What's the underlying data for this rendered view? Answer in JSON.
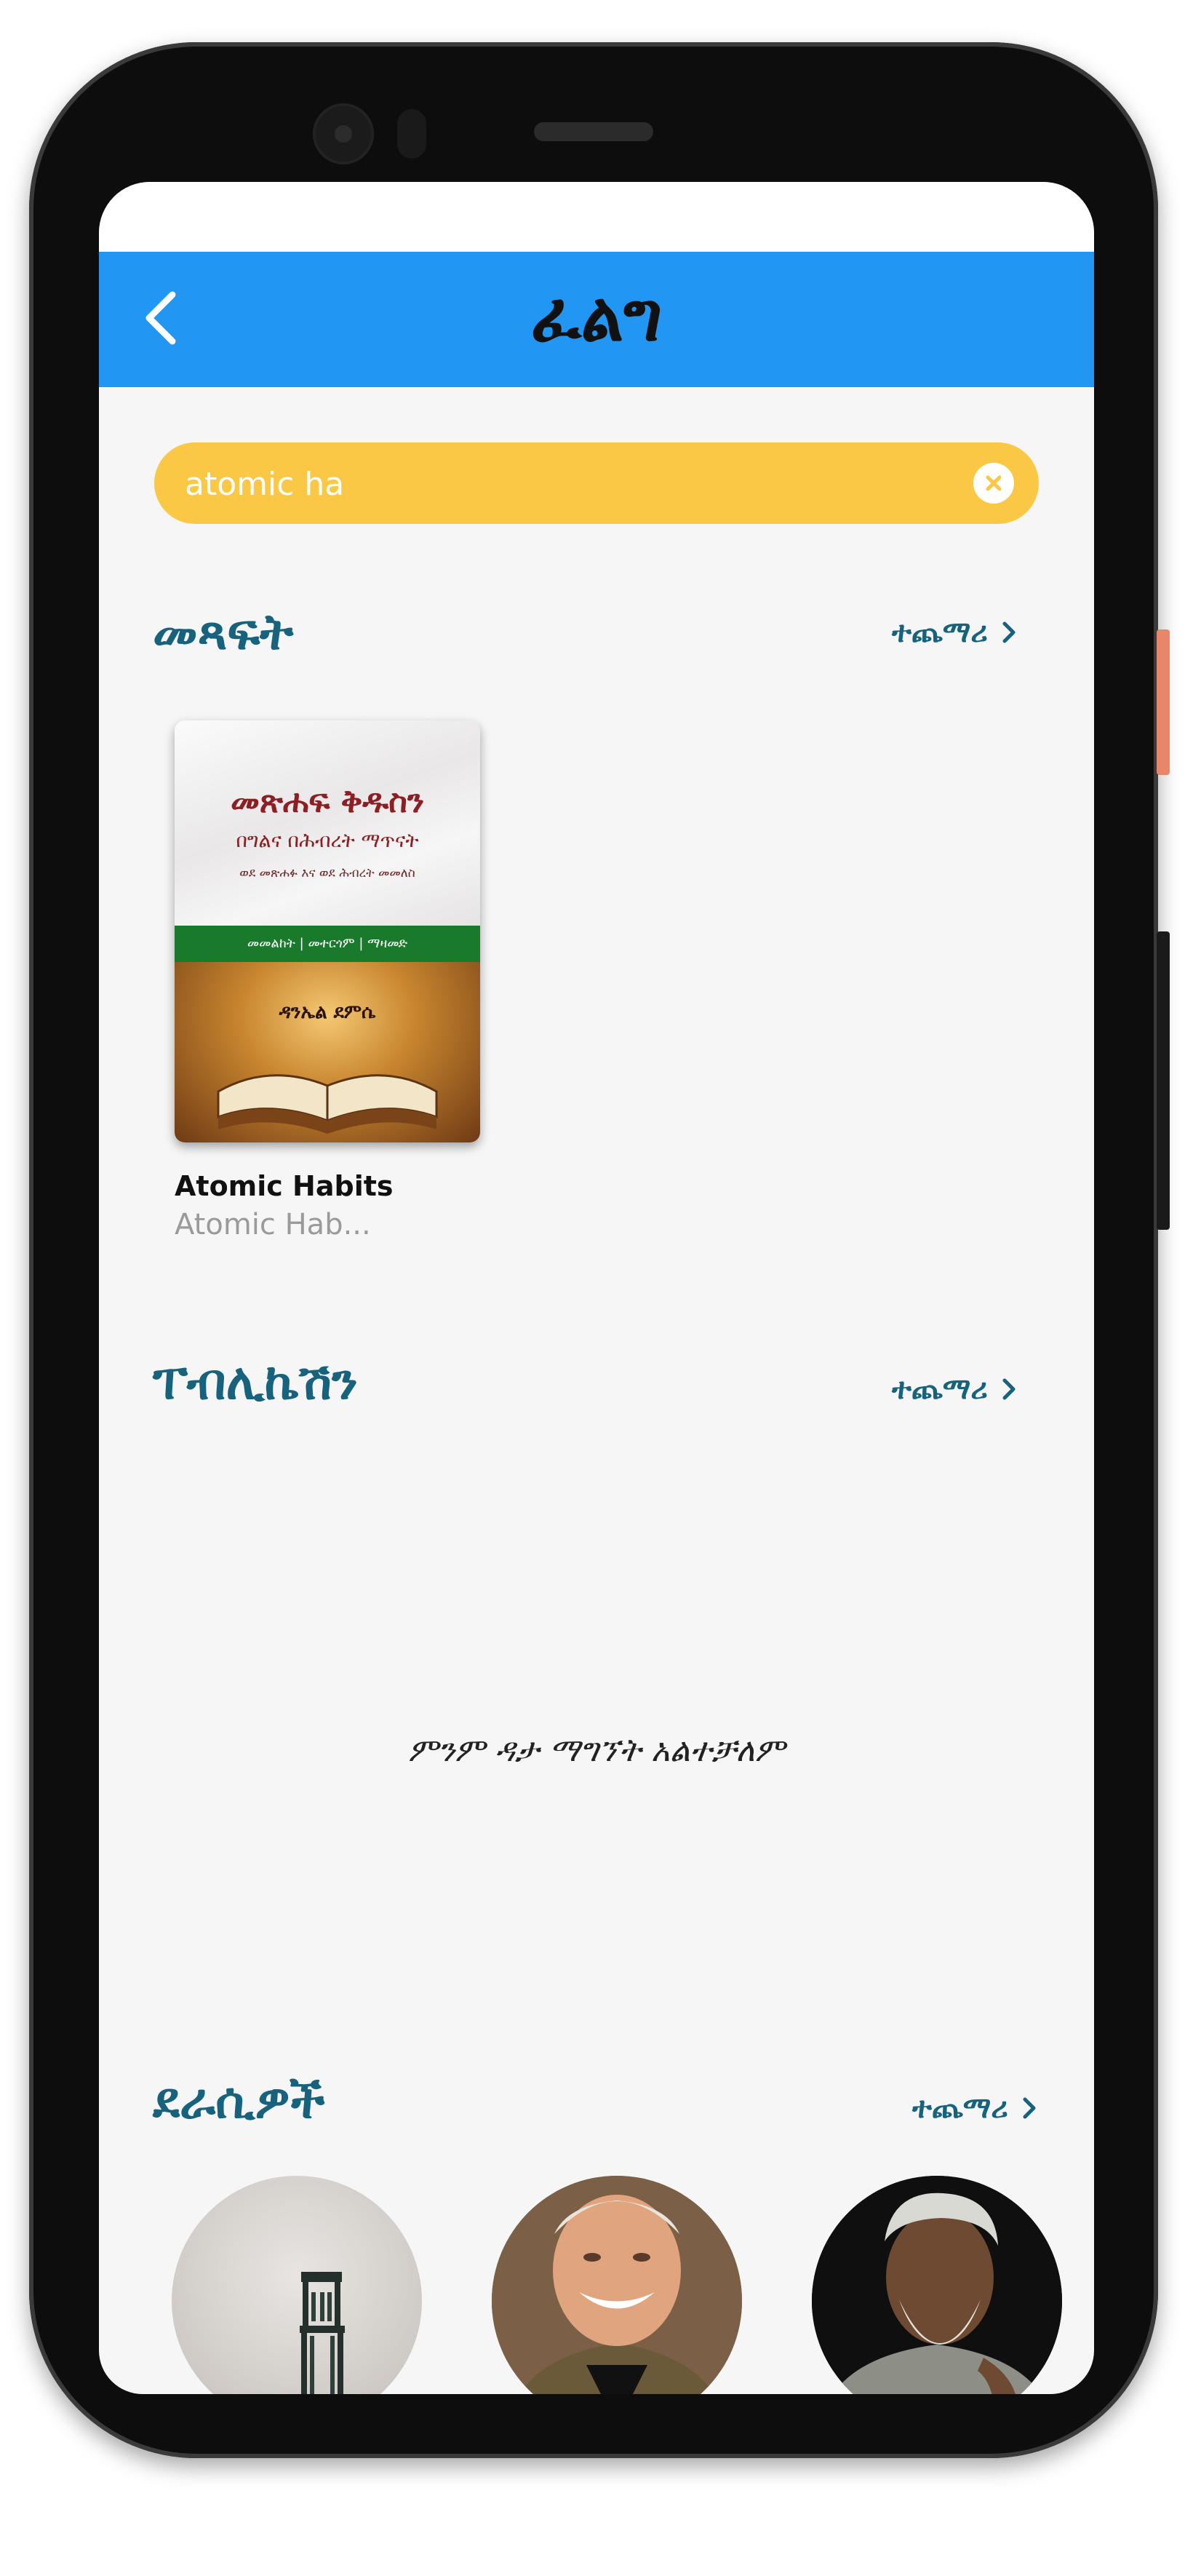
{
  "app_bar": {
    "title": "ፈልግ"
  },
  "search": {
    "value": "atomic ha",
    "placeholder": ""
  },
  "sections": {
    "books": {
      "title": "መጻፍት",
      "more_label": "ተጨማሪ"
    },
    "publications": {
      "title": "ፐብሊኬሽን",
      "more_label": "ተጨማሪ",
      "empty_message": "ምንም ዳታ ማግኘት አልተቻለም"
    },
    "authors": {
      "title": "ደራሲዎች",
      "more_label": "ተጨማሪ"
    }
  },
  "books": [
    {
      "title": "Atomic Habits",
      "subtitle": "Atomic Hab...",
      "cover": {
        "title": "መጽሐፍ ቅዱስን",
        "subtitle": "በግልና በሕብረት ማጥናት",
        "small_text": "ወደ መጽሐፉ እና ወደ ሕብረት መመለስ",
        "band_text": "መመልከት | መተርጎም | ማዛመድ",
        "author": "ዳንኤል ደምሴ"
      }
    }
  ],
  "colors": {
    "app_bar": "#2196f3",
    "search_bg": "#fbc846",
    "section_title": "#17627d",
    "background": "#f6f6f6"
  }
}
